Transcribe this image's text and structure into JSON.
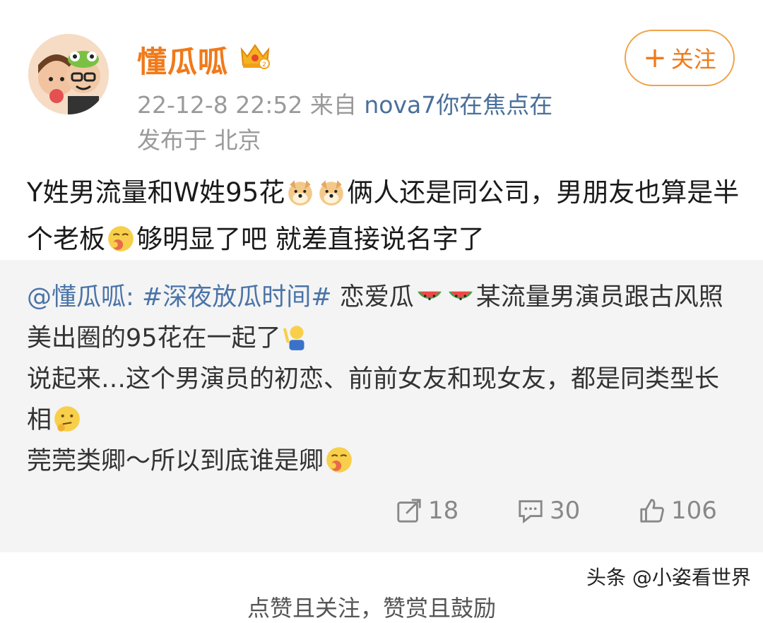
{
  "post": {
    "username": "懂瓜呱",
    "timestamp": "22-12-8 22:52",
    "source_prefix": "来自",
    "device": "nova7你在焦点在",
    "location": "发布于 北京",
    "follow_label": "关注",
    "follow_plus": "+",
    "content_part1": "Y姓男流量和W姓95花",
    "content_part2": "俩人还是同公司，男朋友也算是半个老板",
    "content_part3": "够明显了吧 就差直接说名字了"
  },
  "repost": {
    "mention": "@懂瓜呱:",
    "hashtag": "#深夜放瓜时间#",
    "text1": "恋爱瓜",
    "text2": "某流量男演员跟古风照美出圈的95花在一起了",
    "line3": "说起来…这个男演员的初恋、前前女友和现女友，都是同类型长相",
    "line4": "莞莞类卿～所以到底谁是卿"
  },
  "actions": {
    "share_count": "18",
    "comment_count": "30",
    "like_count": "106"
  },
  "watermark": "头条 @小姿看世界",
  "bottom_cut_text": "点赞且关注，赞赏且鼓励",
  "colors": {
    "username": "#f07a1a",
    "link": "#4a74a8",
    "device": "#4a6f9a",
    "meta": "#9a9a9a",
    "repost_bg": "#f4f4f4"
  }
}
